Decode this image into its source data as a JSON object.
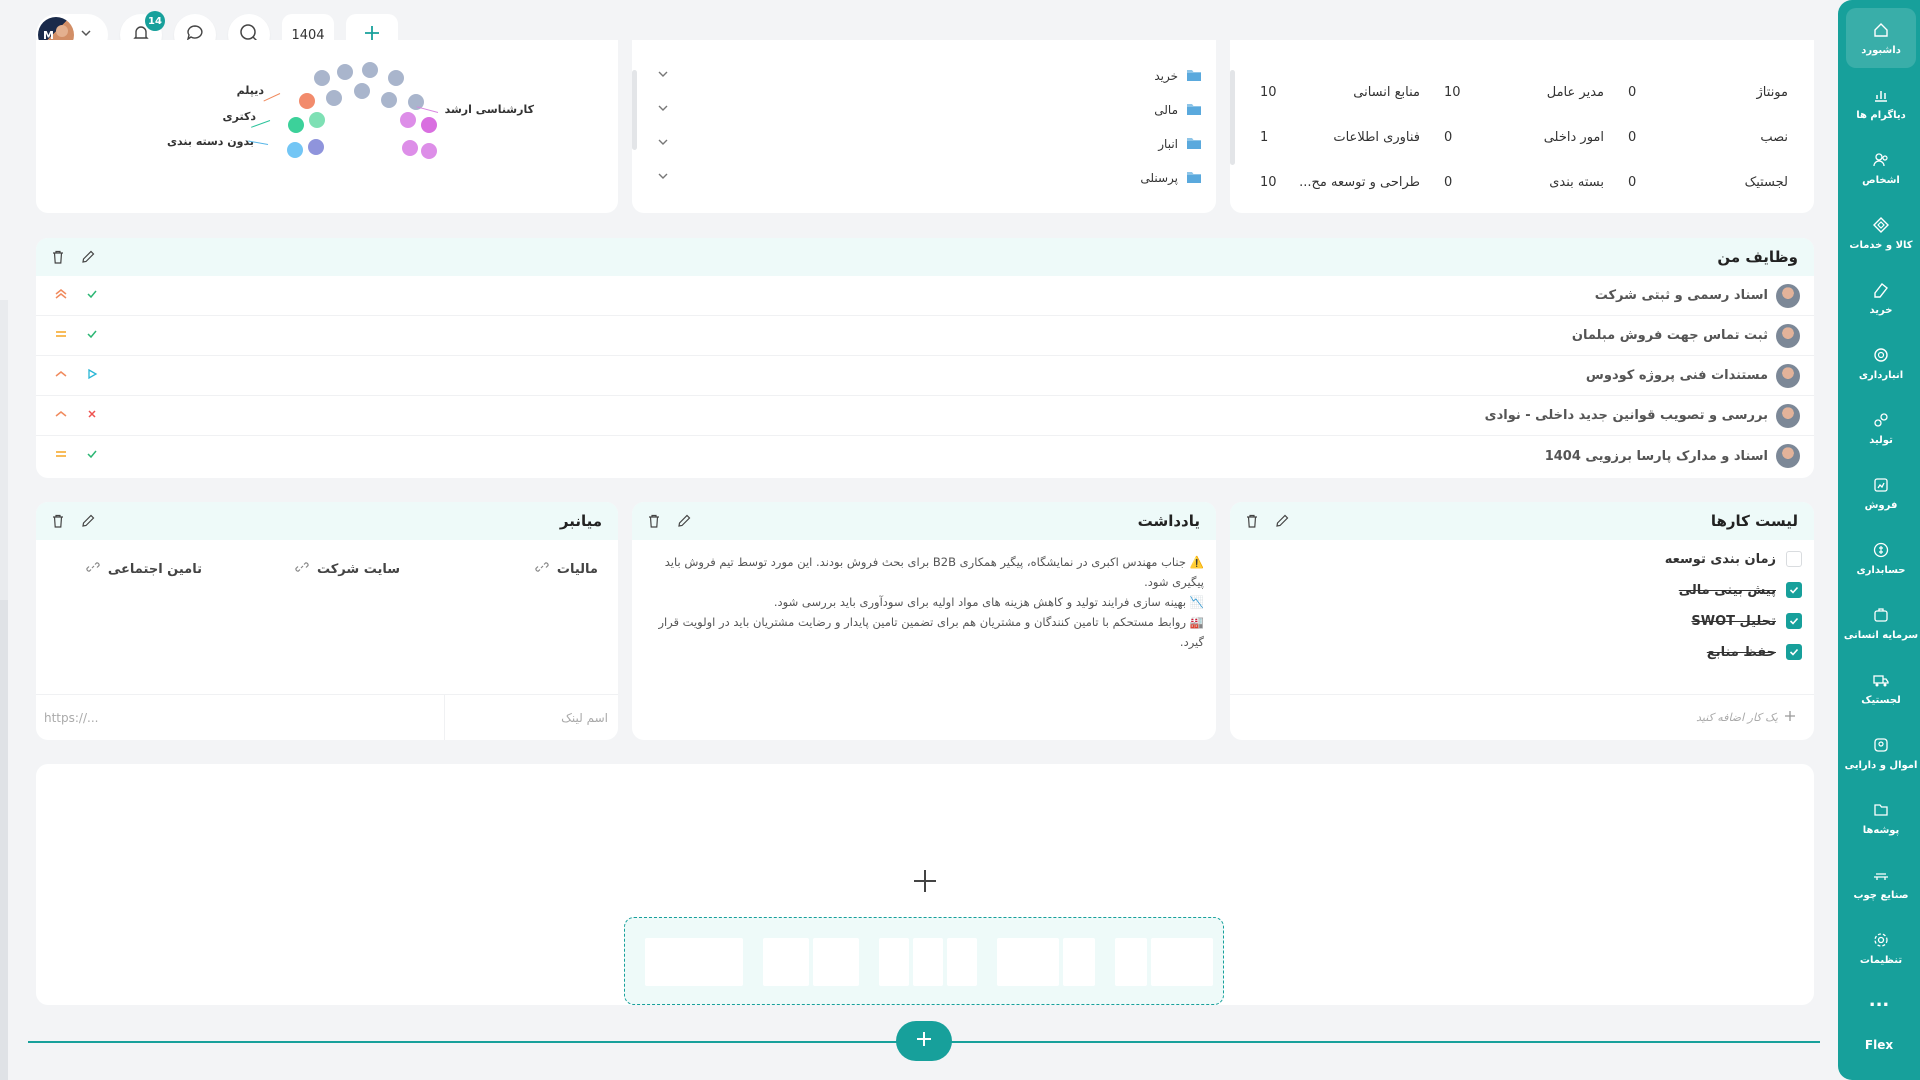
{
  "sidebar": {
    "items": [
      {
        "label": "داشبورد",
        "icon": "home-icon"
      },
      {
        "label": "دیاگرام ها",
        "icon": "chart-icon"
      },
      {
        "label": "اشخاص",
        "icon": "users-icon"
      },
      {
        "label": "کالا و خدمات",
        "icon": "box-icon"
      },
      {
        "label": "خرید",
        "icon": "purchase-icon"
      },
      {
        "label": "انبارداری",
        "icon": "warehouse-icon"
      },
      {
        "label": "تولید",
        "icon": "production-icon"
      },
      {
        "label": "فروش",
        "icon": "sales-icon"
      },
      {
        "label": "حسابداری",
        "icon": "accounting-icon"
      },
      {
        "label": "سرمایه انسانی",
        "icon": "hr-icon"
      },
      {
        "label": "لجستیک",
        "icon": "logistics-icon"
      },
      {
        "label": "اموال و دارایی",
        "icon": "assets-icon"
      },
      {
        "label": "پوشه‌ها",
        "icon": "folder-icon"
      },
      {
        "label": "صنایع چوب",
        "icon": "wood-icon"
      },
      {
        "label": "تنظیمات",
        "icon": "settings-icon"
      }
    ],
    "more": "...",
    "brand": "Flex"
  },
  "topbar": {
    "notification_count": "14",
    "year": "1404"
  },
  "chart": {
    "labels": {
      "diploma": "دیپلم",
      "doctorate": "دکتری",
      "uncategorized": "بدون دسته بندی",
      "masters": "کارشناسی ارشد"
    }
  },
  "folders": [
    {
      "name": "خرید"
    },
    {
      "name": "مالی"
    },
    {
      "name": "انبار"
    },
    {
      "name": "پرسنلی"
    }
  ],
  "departments": [
    [
      {
        "name": "مونتاژ",
        "count": "0"
      },
      {
        "name": "مدیر عامل",
        "count": "10"
      },
      {
        "name": "منابع انسانی",
        "count": "10"
      }
    ],
    [
      {
        "name": "نصب",
        "count": "0"
      },
      {
        "name": "امور داخلی",
        "count": "0"
      },
      {
        "name": "فناوری اطلاعات",
        "count": "1"
      }
    ],
    [
      {
        "name": "لجستیک",
        "count": "0"
      },
      {
        "name": "بسته بندی",
        "count": "0"
      },
      {
        "name": "طراحی و توسعه مح...",
        "count": "10"
      }
    ]
  ],
  "tasks": {
    "title": "وظایف من",
    "items": [
      {
        "text": "اسناد رسمی و ثبتی شرکت",
        "priority": "highest",
        "status": "done"
      },
      {
        "text": "ثبت تماس جهت فروش مبلمان",
        "priority": "medium",
        "status": "done"
      },
      {
        "text": "مستندات فنی پروژه کودوس",
        "priority": "high",
        "status": "in-progress"
      },
      {
        "text": "بررسی و تصویب قوانین جدید داخلی - نوادی",
        "priority": "high",
        "status": "cancelled"
      },
      {
        "text": "اسناد و مدارک پارسا برزویی 1404",
        "priority": "medium",
        "status": "done"
      }
    ]
  },
  "todo": {
    "title": "لیست کارها",
    "items": [
      {
        "text": "زمان بندی توسعه",
        "checked": false
      },
      {
        "text": "پیش بینی مالی",
        "checked": true
      },
      {
        "text": "تحلیل SWOT",
        "checked": true
      },
      {
        "text": "حفظ منابع",
        "checked": true
      }
    ],
    "add_placeholder": "یک کار اضافه کنید"
  },
  "note": {
    "title": "یادداشت",
    "lines": [
      "⚠️ جناب مهندس اکبری در نمایشگاه، پیگیر همکاری B2B برای بحث فروش بودند. این مورد توسط تیم فروش باید پیگیری شود.",
      "📉 بهینه سازی فرایند تولید و کاهش هزینه های مواد اولیه برای سودآوری باید بررسی شود.",
      "🏭 روابط مستحکم با تامین کنندگان و مشتریان هم برای تضمین  تامین پایدار و رضایت مشتریان باید در اولویت قرار گیرد."
    ]
  },
  "shortcuts": {
    "title": "میانبر",
    "items": [
      {
        "label": "مالیات"
      },
      {
        "label": "سایت شرکت"
      },
      {
        "label": "تامین اجتماعی"
      }
    ],
    "name_placeholder": "اسم لینک",
    "url_placeholder": "https://..."
  },
  "colors": {
    "accent": "#17a09b",
    "accent_light": "#eefaf9",
    "priority_high": "#f08a5d",
    "priority_medium": "#f5a623",
    "status_done": "#2bb673",
    "status_progress": "#29b6d6",
    "status_cancel": "#ef5350"
  }
}
